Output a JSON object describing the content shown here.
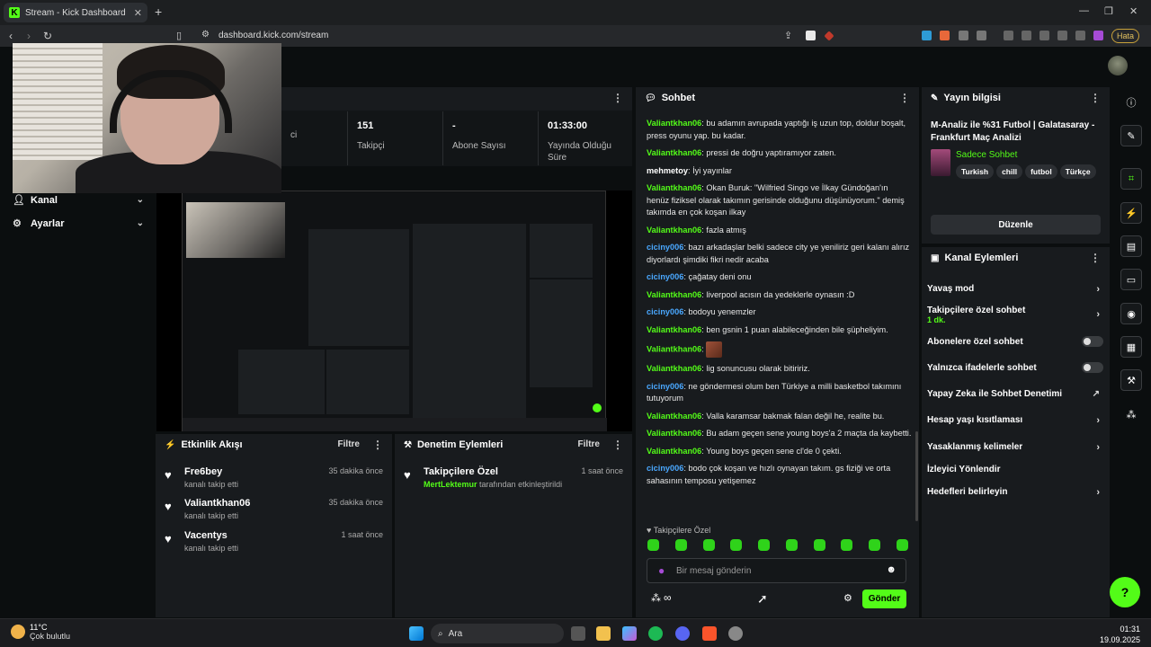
{
  "browser": {
    "tab_title": "Stream - Kick Dashboard",
    "favicon_letter": "K",
    "url": "dashboard.kick.com/stream",
    "error_badge": "Hata"
  },
  "stats": [
    {
      "value": "151",
      "label": "Takipçi"
    },
    {
      "value": "-",
      "label": "Abone Sayısı"
    },
    {
      "value": "01:33:00",
      "label": "Yayında Olduğu Süre"
    }
  ],
  "stats_partial_label": "ci",
  "left_nav": [
    {
      "label": "Kanal",
      "icon": "user-icon"
    },
    {
      "label": "Ayarlar",
      "icon": "gear-icon"
    }
  ],
  "activity": {
    "title": "Etkinlik Akışı",
    "filter": "Filtre",
    "events": [
      {
        "name": "Fre6bey",
        "sub": "kanalı takip etti",
        "time": "35 dakika önce"
      },
      {
        "name": "Valiantkhan06",
        "sub": "kanalı takip etti",
        "time": "35 dakika önce"
      },
      {
        "name": "Vacentys",
        "sub": "kanalı takip etti",
        "time": "1 saat önce"
      }
    ]
  },
  "moderation": {
    "title": "Denetim Eylemleri",
    "filter": "Filtre",
    "item_title": "Takipçilere Özel",
    "item_user": "MertLektemur",
    "item_text": "tarafından etkinleştirildi",
    "item_time": "1 saat önce"
  },
  "chat": {
    "title": "Sohbet",
    "messages": [
      {
        "user": "Valiantkhan06",
        "color": "g",
        "text": "bu adamın avrupada yaptığı iş uzun top, doldur boşalt, press oyunu yap. bu kadar."
      },
      {
        "user": "Valiantkhan06",
        "color": "g",
        "text": "pressi de doğru yaptıramıyor zaten."
      },
      {
        "user": "mehmetoy",
        "color": "w",
        "text": "İyi yayınlar"
      },
      {
        "user": "Valiantkhan06",
        "color": "g",
        "text": "Okan Buruk: \"Wilfried Singo ve İlkay Gündoğan'ın henüz fiziksel olarak takımın gerisinde olduğunu düşünüyorum.\" demiş takımda en çok koşan ilkay"
      },
      {
        "user": "Valiantkhan06",
        "color": "g",
        "text": "fazla atmış"
      },
      {
        "user": "ciciny006",
        "color": "b",
        "text": "bazı arkadaşlar belki sadece city ye yeniliriz geri kalanı alırız diyorlardı şimdiki fikri nedir acaba"
      },
      {
        "user": "ciciny006",
        "color": "b",
        "text": "çağatay deni onu"
      },
      {
        "user": "Valiantkhan06",
        "color": "g",
        "text": "liverpool acısın da yedeklerle oynasın :D"
      },
      {
        "user": "ciciny006",
        "color": "b",
        "text": "bodoyu yenemzler"
      },
      {
        "user": "Valiantkhan06",
        "color": "g",
        "text": "ben gsnin 1 puan alabileceğinden bile şüpheliyim."
      },
      {
        "user": "Valiantkhan06",
        "color": "g",
        "text": ""
      },
      {
        "user": "Valiantkhan06",
        "color": "g",
        "text": "lig sonuncusu olarak bitiririz."
      },
      {
        "user": "ciciny006",
        "color": "b",
        "text": "ne göndermesi olum ben Türkiye a milli basketbol takımını tutuyorum"
      },
      {
        "user": "Valiantkhan06",
        "color": "g",
        "text": "Valla karamsar bakmak falan değil he, realite bu."
      },
      {
        "user": "Valiantkhan06",
        "color": "g",
        "text": "Bu adam geçen sene young boys'a 2 maçta da kaybetti."
      },
      {
        "user": "Valiantkhan06",
        "color": "g",
        "text": "Young boys geçen sene cl'de 0 çekti."
      },
      {
        "user": "ciciny006",
        "color": "b",
        "text": "bodo çok koşan ve hızlı oynayan takım. gs fiziği ve orta sahasının temposu yetişemez"
      }
    ],
    "mode_label": "Takipçilere Özel",
    "input_placeholder": "Bir mesaj gönderin",
    "send_label": "Gönder"
  },
  "stream_info": {
    "title": "Yayın bilgisi",
    "stream_title": "M-Analiz ile %31 Futbol | Galatasaray - Frankfurt Maç Analizi",
    "category": "Sadece Sohbet",
    "tags": [
      "Turkish",
      "chill",
      "futbol",
      "Türkçe"
    ],
    "edit_label": "Düzenle"
  },
  "channel_actions": {
    "title": "Kanal Eylemleri",
    "items": [
      {
        "label": "Yavaş mod",
        "kind": "chevron"
      },
      {
        "label": "Takipçilere özel sohbet",
        "sub": "1 dk.",
        "kind": "chevron"
      },
      {
        "label": "Abonelere özel sohbet",
        "kind": "toggle"
      },
      {
        "label": "Yalnızca ifadelerle sohbet",
        "kind": "toggle"
      },
      {
        "label": "Yapay Zeka ile Sohbet Denetimi",
        "kind": "external"
      },
      {
        "label": "Hesap yaşı kısıtlaması",
        "kind": "chevron"
      },
      {
        "label": "Yasaklanmış kelimeler",
        "kind": "chevron"
      },
      {
        "label": "İzleyici Yönlendir",
        "kind": "none"
      },
      {
        "label": "Hedefleri belirleyin",
        "kind": "chevron"
      }
    ]
  },
  "taskbar": {
    "temp": "11°C",
    "weather": "Çok bulutlu",
    "search": "Ara",
    "time": "01:31",
    "date": "19.09.2025"
  },
  "colors": {
    "accent": "#53fc18",
    "bg": "#0b0e0f",
    "panel": "#181b1e",
    "user_blue": "#4aa8ff"
  }
}
